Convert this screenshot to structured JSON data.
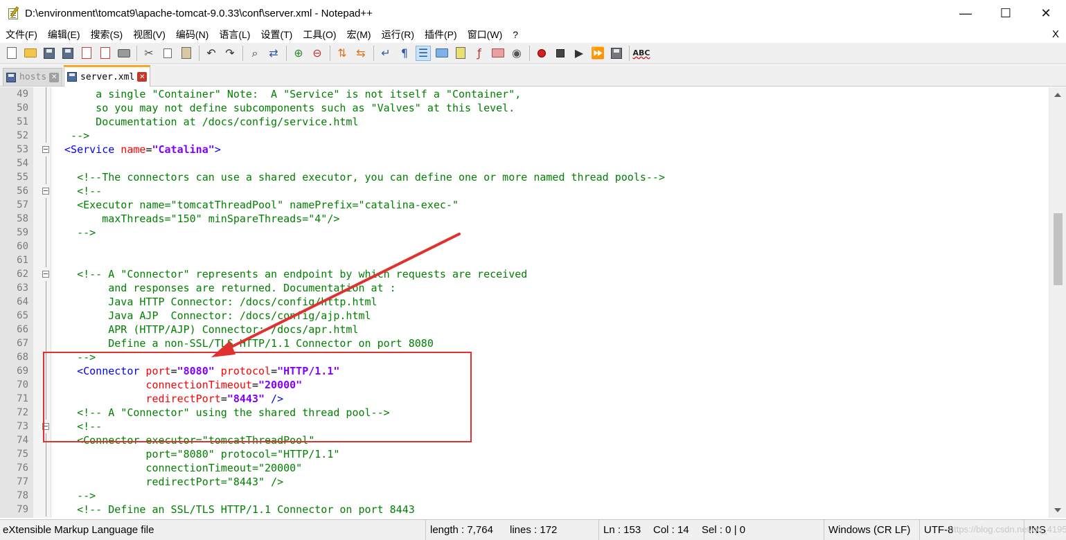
{
  "window": {
    "title": "D:\\environment\\tomcat9\\apache-tomcat-9.0.33\\conf\\server.xml - Notepad++",
    "minimize": "—",
    "maximize": "☐",
    "close": "✕"
  },
  "menu": {
    "items": [
      "文件(F)",
      "编辑(E)",
      "搜索(S)",
      "视图(V)",
      "编码(N)",
      "语言(L)",
      "设置(T)",
      "工具(O)",
      "宏(M)",
      "运行(R)",
      "插件(P)",
      "窗口(W)",
      "?"
    ],
    "close": "X"
  },
  "toolbar": {
    "icons": [
      "new-file-icon",
      "open-file-icon",
      "save-icon",
      "save-all-icon",
      "close-icon",
      "close-all-icon",
      "print-icon",
      "cut-icon",
      "copy-icon",
      "paste-icon",
      "undo-icon",
      "redo-icon",
      "find-icon",
      "replace-icon",
      "zoom-in-icon",
      "zoom-out-icon",
      "sync-vertical-icon",
      "sync-horizontal-icon",
      "word-wrap-icon",
      "show-all-chars-icon",
      "indent-guide-icon",
      "user-language-icon",
      "doc-map-icon",
      "function-list-icon",
      "folder-workspace-icon",
      "monitoring-icon",
      "record-macro-icon",
      "stop-recording-icon",
      "playback-macro-icon",
      "run-macro-multiple-icon",
      "save-macro-icon",
      "spell-check-icon"
    ],
    "spell_label": "ABC"
  },
  "tabs": [
    {
      "label": "hosts",
      "active": false
    },
    {
      "label": "server.xml",
      "active": true
    }
  ],
  "editor": {
    "lines": [
      {
        "n": "49"
      },
      {
        "n": "50"
      },
      {
        "n": "51"
      },
      {
        "n": "52"
      },
      {
        "n": "53"
      },
      {
        "n": "54"
      },
      {
        "n": "55"
      },
      {
        "n": "56"
      },
      {
        "n": "57"
      },
      {
        "n": "58"
      },
      {
        "n": "59"
      },
      {
        "n": "60"
      },
      {
        "n": "61"
      },
      {
        "n": "62"
      },
      {
        "n": "63"
      },
      {
        "n": "64"
      },
      {
        "n": "65"
      },
      {
        "n": "66"
      },
      {
        "n": "67"
      },
      {
        "n": "68"
      },
      {
        "n": "69"
      },
      {
        "n": "70"
      },
      {
        "n": "71"
      },
      {
        "n": "72"
      },
      {
        "n": "73"
      },
      {
        "n": "74"
      },
      {
        "n": "75"
      },
      {
        "n": "76"
      },
      {
        "n": "77"
      },
      {
        "n": "78"
      },
      {
        "n": "79"
      }
    ],
    "text": {
      "l49": "      a single \"Container\" Note:  A \"Service\" is not itself a \"Container\",",
      "l50": "      so you may not define subcomponents such as \"Valves\" at this level.",
      "l51": "      Documentation at /docs/config/service.html",
      "l52": "  -->",
      "l53_tag": " <Service",
      "l53_attr": " name",
      "l53_eq": "=",
      "l53_val": "\"Catalina\"",
      "l53_end": ">",
      "l55": "   <!--The connectors can use a shared executor, you can define one or more named thread pools-->",
      "l56": "   <!--",
      "l57": "   <Executor name=\"tomcatThreadPool\" namePrefix=\"catalina-exec-\"",
      "l58": "       maxThreads=\"150\" minSpareThreads=\"4\"/>",
      "l59": "   -->",
      "l62": "   <!-- A \"Connector\" represents an endpoint by which requests are received",
      "l63": "        and responses are returned. Documentation at :",
      "l64": "        Java HTTP Connector: /docs/config/http.html",
      "l65": "        Java AJP  Connector: /docs/config/ajp.html",
      "l66": "        APR (HTTP/AJP) Connector: /docs/apr.html",
      "l67": "        Define a non-SSL/TLS HTTP/1.1 Connector on port 8080",
      "l68": "   -->",
      "l69_tag": "   <Connector",
      "l69_a1": " port",
      "l69_eq1": "=",
      "l69_v1": "\"8080\"",
      "l69_a2": " protocol",
      "l69_eq2": "=",
      "l69_v2": "\"HTTP/1.1\"",
      "l70_a": "              connectionTimeout",
      "l70_eq": "=",
      "l70_v": "\"20000\"",
      "l71_a": "              redirectPort",
      "l71_eq": "=",
      "l71_v": "\"8443\"",
      "l71_end": " />",
      "l72": "   <!-- A \"Connector\" using the shared thread pool-->",
      "l73": "   <!--",
      "l74": "   <Connector executor=\"tomcatThreadPool\"",
      "l75": "              port=\"8080\" protocol=\"HTTP/1.1\"",
      "l76": "              connectionTimeout=\"20000\"",
      "l77": "              redirectPort=\"8443\" />",
      "l78": "   -->",
      "l79": "   <!-- Define an SSL/TLS HTTP/1.1 Connector on port 8443"
    }
  },
  "statusbar": {
    "filetype": "eXtensible Markup Language file",
    "length": "length : 7,764",
    "lines": "lines : 172",
    "ln": "Ln : 153",
    "col": "Col : 14",
    "sel": "Sel : 0 | 0",
    "eol": "Windows (CR LF)",
    "encoding": "UTF-8",
    "mode": "INS"
  },
  "watermark": "https://blog.csdn.net/qq_41951349",
  "colors": {
    "comment": "#008000",
    "tag": "#0000ff",
    "attribute": "#ff0000",
    "value": "#8000ff",
    "annotation": "#e03030"
  }
}
